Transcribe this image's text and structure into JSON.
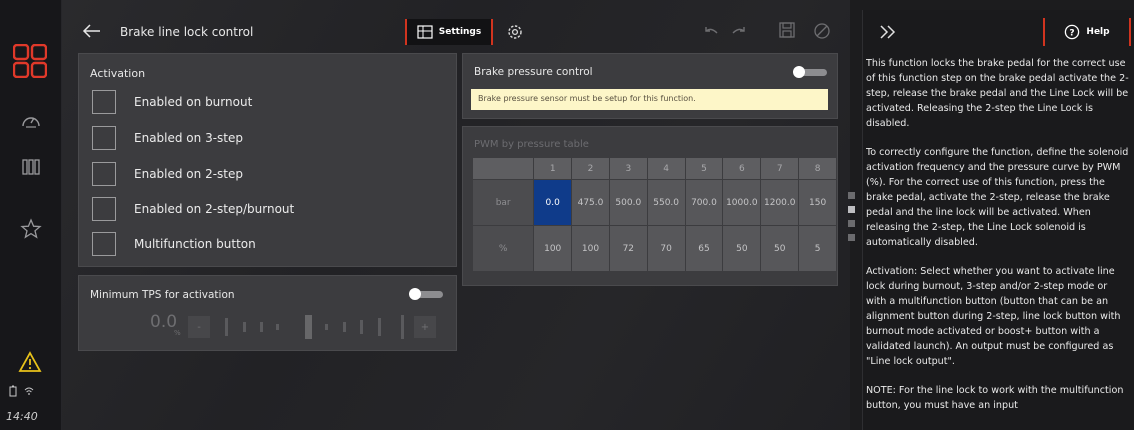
{
  "rail": {
    "icons": [
      "dashboard-grid-icon",
      "gauge-icon",
      "bars-icon",
      "star-icon",
      "warning-icon"
    ],
    "status_icons": [
      "battery-icon",
      "wifi-icon"
    ],
    "time": "14:40"
  },
  "header": {
    "title": "Brake line lock control",
    "settings_label": "Settings"
  },
  "activation": {
    "label": "Activation",
    "options": [
      {
        "label": "Enabled on burnout",
        "checked": false
      },
      {
        "label": "Enabled on 3-step",
        "checked": false
      },
      {
        "label": "Enabled on 2-step",
        "checked": false
      },
      {
        "label": "Enabled on 2-step/burnout",
        "checked": false
      },
      {
        "label": "Multifunction button",
        "checked": false
      }
    ]
  },
  "tps": {
    "label": "Minimum TPS for activation",
    "value": "0.0",
    "unit": "%",
    "minus": "-",
    "plus": "+",
    "enabled": false
  },
  "brake_pressure": {
    "label": "Brake pressure control",
    "enabled": false,
    "warning": "Brake pressure sensor must be setup for this function."
  },
  "pwm_table": {
    "title": "PWM by pressure table",
    "columns": [
      "1",
      "2",
      "3",
      "4",
      "5",
      "6",
      "7",
      "8"
    ],
    "rows": [
      {
        "label": "bar",
        "values": [
          "0.0",
          "475.0",
          "500.0",
          "550.0",
          "700.0",
          "1000.0",
          "1200.0",
          "150"
        ]
      },
      {
        "label": "%",
        "values": [
          "100",
          "100",
          "72",
          "70",
          "65",
          "50",
          "50",
          "5"
        ]
      }
    ],
    "selected_cell": "bar-1"
  },
  "help": {
    "button_label": "Help",
    "paragraphs": [
      "This function locks the brake pedal for the correct use of this function step on the brake pedal activate the 2-step, release the brake pedal and the Line Lock will be activated. Releasing the 2-step the Line Lock is disabled.",
      "To correctly configure the function, define the solenoid activation frequency and the pressure curve by PWM (%). For the correct use of this function, press the brake pedal, activate the 2-step, release the brake pedal and the line lock will be activated. When releasing the 2-step, the Line Lock solenoid is automatically disabled.",
      "Activation: Select whether you want to activate line lock during burnout, 3-step and/or 2-step mode or with a multifunction button (button that can be an alignment button during 2-step, line lock button with burnout mode activated or boost+ button with a validated launch). An output must be configured as \"Line lock output\".",
      "NOTE: For the line lock to work with the multifunction button, you must have an input"
    ]
  },
  "colors": {
    "accent": "#d1341f",
    "selected_cell": "#0f3b8a",
    "warning_bg": "#fdf6c8",
    "warning_icon": "#e8c21a"
  }
}
